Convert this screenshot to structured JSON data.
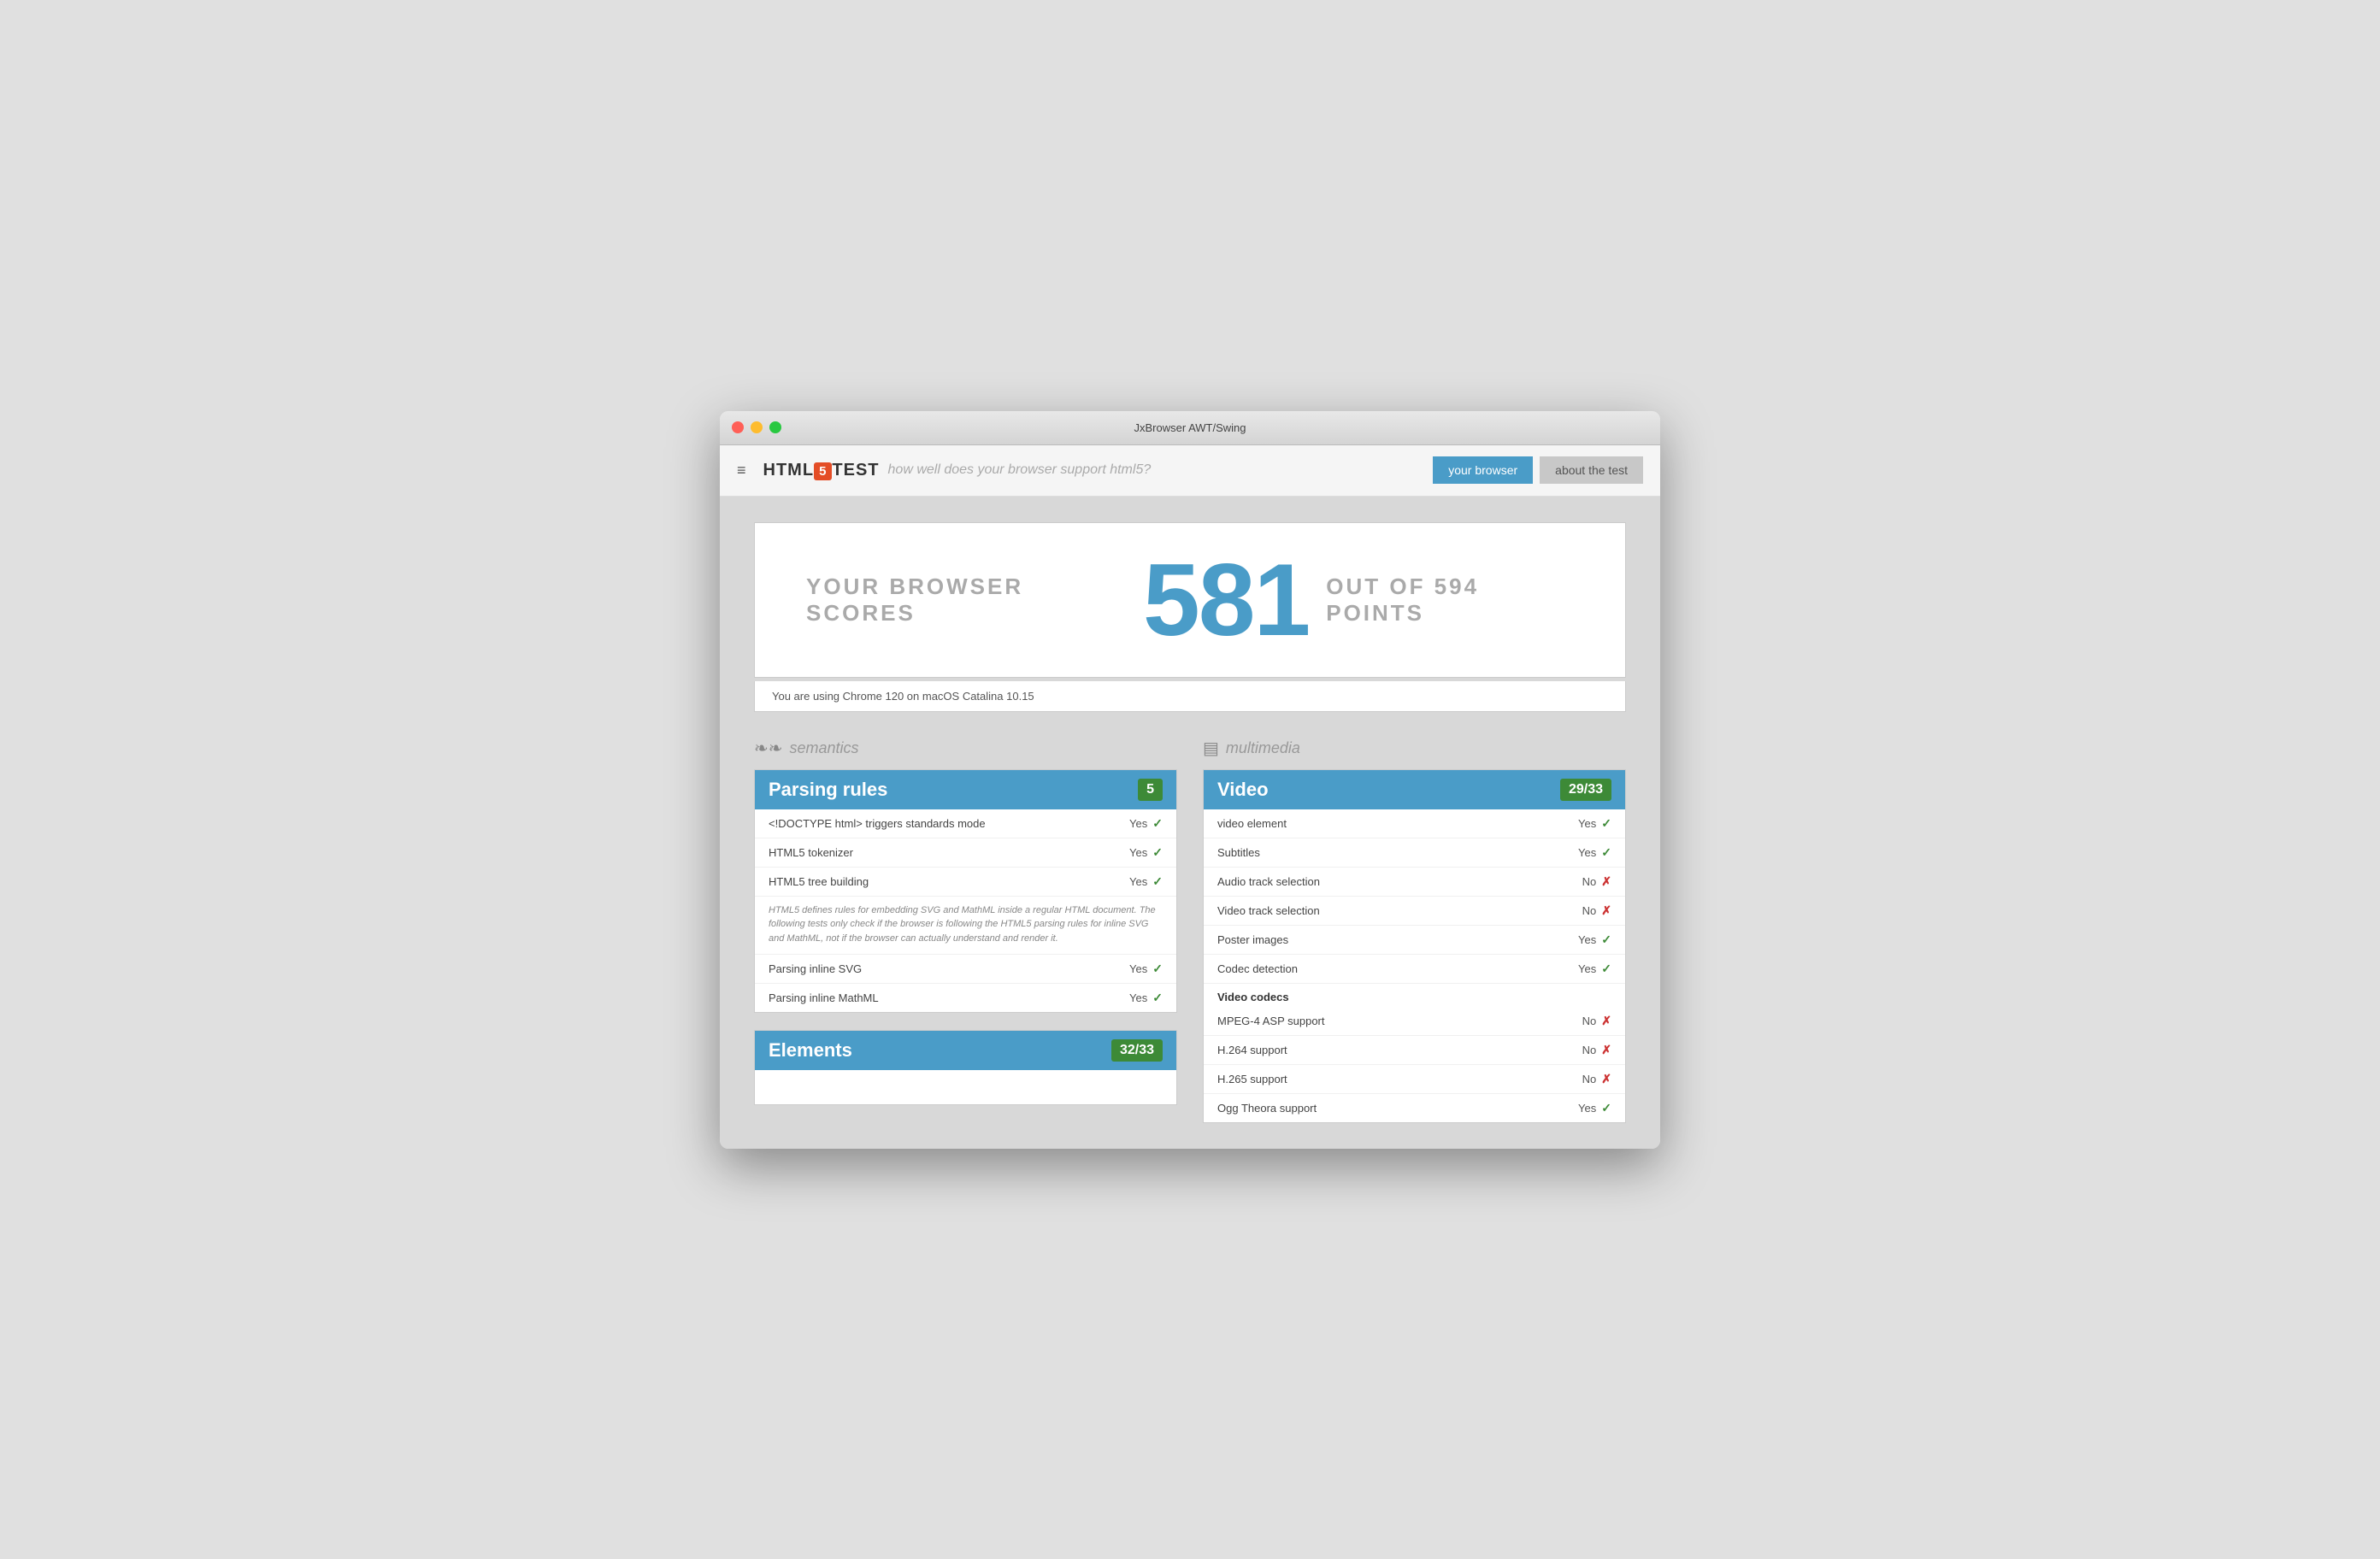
{
  "window": {
    "title": "JxBrowser AWT/Swing"
  },
  "navbar": {
    "hamburger": "≡",
    "brand": {
      "html5": "5",
      "text_before": "HTML",
      "text_after": "TEST",
      "subtitle": "how well does your browser support html5?"
    },
    "buttons": {
      "your_browser": "your browser",
      "about_the_test": "about the test"
    }
  },
  "score": {
    "label_before": "YOUR BROWSER SCORES",
    "number": "581",
    "label_after": "OUT OF 594 POINTS"
  },
  "browser_info": "You are using Chrome 120 on macOS Catalina 10.15",
  "sections": [
    {
      "id": "semantics",
      "icon": "❧",
      "label": "semantics",
      "categories": [
        {
          "title": "Parsing rules",
          "score": "5",
          "tests": [
            {
              "name": "<!DOCTYPE html> triggers standards mode",
              "result": "Yes",
              "pass": true
            },
            {
              "name": "HTML5 tokenizer",
              "result": "Yes",
              "pass": true
            },
            {
              "name": "HTML5 tree building",
              "result": "Yes",
              "pass": true
            }
          ],
          "note": "HTML5 defines rules for embedding SVG and MathML inside a regular HTML document. The following tests only check if the browser is following the HTML5 parsing rules for inline SVG and MathML, not if the browser can actually understand and render it.",
          "tests2": [
            {
              "name": "Parsing inline SVG",
              "result": "Yes",
              "pass": true
            },
            {
              "name": "Parsing inline MathML",
              "result": "Yes",
              "pass": true
            }
          ]
        },
        {
          "title": "Elements",
          "score": "32/33",
          "tests": []
        }
      ]
    },
    {
      "id": "multimedia",
      "icon": "▤",
      "label": "multimedia",
      "categories": [
        {
          "title": "Video",
          "score": "29/33",
          "tests": [
            {
              "name": "video element",
              "result": "Yes",
              "pass": true
            },
            {
              "name": "Subtitles",
              "result": "Yes",
              "pass": true
            },
            {
              "name": "Audio track selection",
              "result": "No",
              "pass": false
            },
            {
              "name": "Video track selection",
              "result": "No",
              "pass": false
            },
            {
              "name": "Poster images",
              "result": "Yes",
              "pass": true
            },
            {
              "name": "Codec detection",
              "result": "Yes",
              "pass": true
            }
          ],
          "subsection": "Video codecs",
          "tests2": [
            {
              "name": "MPEG-4 ASP support",
              "result": "No",
              "pass": false
            },
            {
              "name": "H.264 support",
              "result": "No",
              "pass": false
            },
            {
              "name": "H.265 support",
              "result": "No",
              "pass": false
            },
            {
              "name": "Ogg Theora support",
              "result": "Yes",
              "pass": true
            }
          ]
        }
      ]
    }
  ]
}
